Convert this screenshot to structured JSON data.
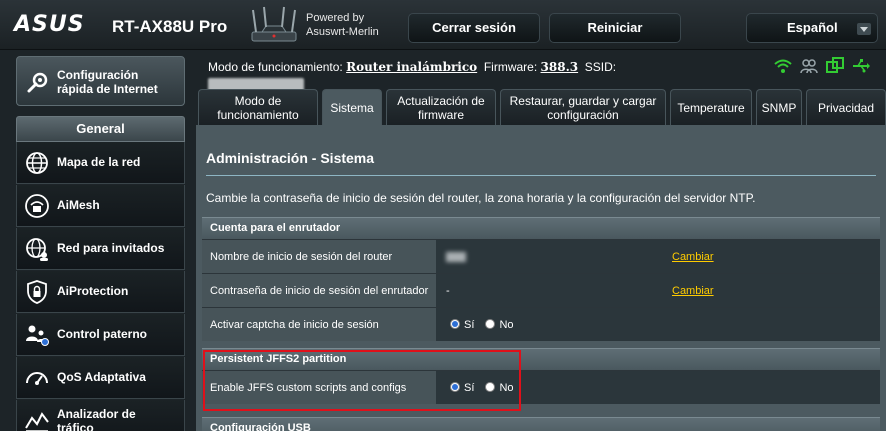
{
  "header": {
    "brand": "ASUS",
    "model": "RT-AX88U Pro",
    "powered_by_line1": "Powered by",
    "powered_by_line2": "Asuswrt-Merlin",
    "logout_label": "Cerrar sesión",
    "reboot_label": "Reiniciar",
    "language": "Español"
  },
  "sidebar": {
    "quick_setup_label": "Configuración rápida de Internet",
    "section_title": "General",
    "items": [
      {
        "label": "Mapa de la red",
        "icon": "globe-network-icon"
      },
      {
        "label": "AiMesh",
        "icon": "aimesh-icon"
      },
      {
        "label": "Red para invitados",
        "icon": "guest-network-icon"
      },
      {
        "label": "AiProtection",
        "icon": "shield-lock-icon"
      },
      {
        "label": "Control paterno",
        "icon": "parental-control-icon"
      },
      {
        "label": "QoS Adaptativa",
        "icon": "speedometer-icon"
      },
      {
        "label": "Analizador de tráfico",
        "icon": "traffic-analyzer-icon"
      }
    ]
  },
  "modebar": {
    "mode_label": "Modo de funcionamiento:",
    "mode_value": "Router inalámbrico",
    "firmware_label": "Firmware:",
    "firmware_value": "388.3",
    "ssid_label": "SSID:"
  },
  "tabs": [
    {
      "label": "Modo de funcionamiento",
      "active": false
    },
    {
      "label": "Sistema",
      "active": true
    },
    {
      "label": "Actualización de firmware",
      "active": false
    },
    {
      "label": "Restaurar, guardar y cargar configuración",
      "active": false
    },
    {
      "label": "Temperature",
      "active": false
    },
    {
      "label": "SNMP",
      "active": false
    },
    {
      "label": "Privacidad",
      "active": false
    }
  ],
  "page": {
    "title": "Administración - Sistema",
    "description": "Cambie la contraseña de inicio de sesión del router, la zona horaria y la configuración del servidor NTP."
  },
  "account_section": {
    "header": "Cuenta para el enrutador",
    "rows": [
      {
        "label": "Nombre de inicio de sesión del router",
        "value": "",
        "link": "Cambiar"
      },
      {
        "label": "Contraseña de inicio de sesión del enrutador",
        "value": "-",
        "link": "Cambiar"
      },
      {
        "label": "Activar captcha de inicio de sesión",
        "yes": "Sí",
        "no": "No",
        "selected": "yes"
      }
    ]
  },
  "jffs_section": {
    "header": "Persistent JFFS2 partition",
    "row_label": "Enable JFFS custom scripts and configs",
    "yes": "Sí",
    "no": "No",
    "selected": "yes"
  },
  "usb_section": {
    "header": "Configuración USB"
  },
  "colors": {
    "accent_link": "#ffcc00",
    "highlight_border": "#e0101a",
    "status_green": "#33cc33"
  }
}
